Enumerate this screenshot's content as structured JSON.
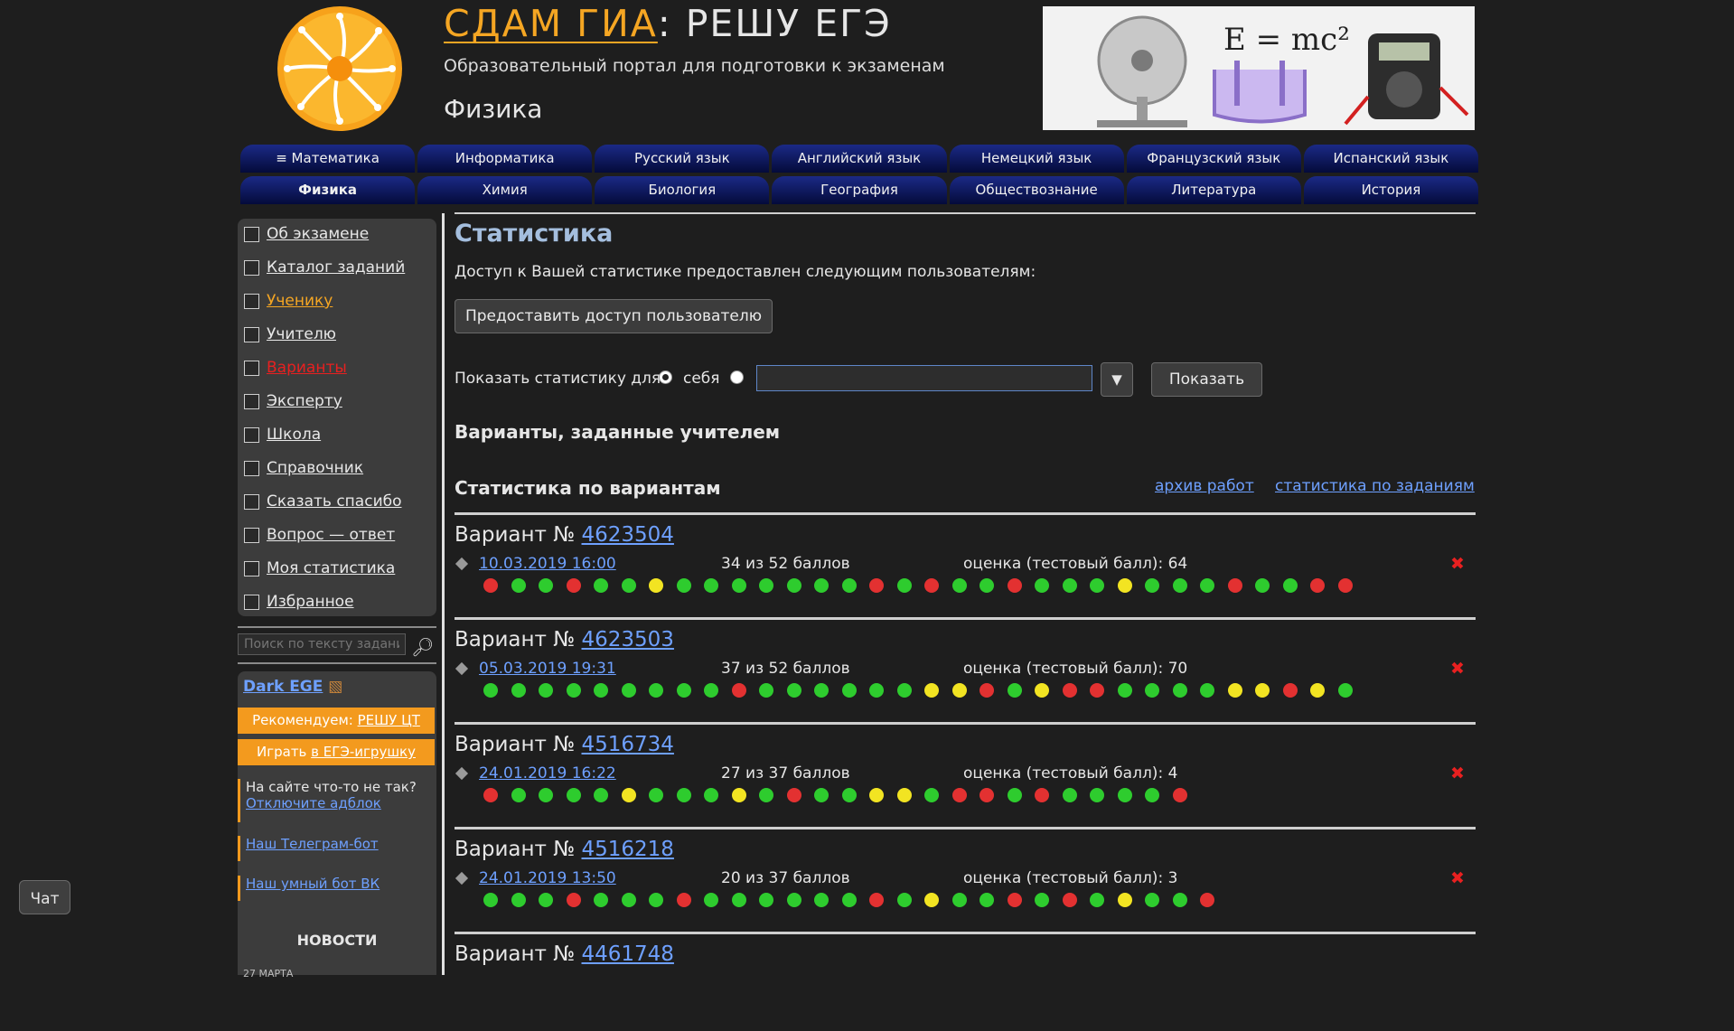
{
  "header": {
    "brand": "СДАМ ГИА",
    "separator": ": ",
    "site": "РЕШУ ЕГЭ",
    "subtitle": "Образовательный портал для подготовки к экзаменам",
    "subject": "Физика",
    "banner_formula": "E = mc²"
  },
  "subject_tabs": {
    "row1": [
      "≡ Математика",
      "Информатика",
      "Русский язык",
      "Английский язык",
      "Немецкий язык",
      "Французский язык",
      "Испанский язык"
    ],
    "row2": [
      "Физика",
      "Химия",
      "Биология",
      "География",
      "Обществознание",
      "Литература",
      "История"
    ],
    "active": "Физика"
  },
  "sidebar": {
    "items": [
      {
        "label": "Об экзамене",
        "style": "normal"
      },
      {
        "label": "Каталог заданий",
        "style": "normal"
      },
      {
        "label": "Ученику",
        "style": "orange"
      },
      {
        "label": "Учителю",
        "style": "normal"
      },
      {
        "label": "Варианты",
        "style": "red"
      },
      {
        "label": "Эксперту",
        "style": "normal"
      },
      {
        "label": "Школа",
        "style": "normal"
      },
      {
        "label": "Справочник",
        "style": "normal"
      },
      {
        "label": "Сказать спасибо",
        "style": "normal"
      },
      {
        "label": "Вопрос — ответ",
        "style": "normal"
      },
      {
        "label": "Моя статистика",
        "style": "normal"
      },
      {
        "label": "Избранное",
        "style": "normal"
      }
    ],
    "search_placeholder": "Поиск по тексту задания",
    "dark_ege": "Dark EGE",
    "promo1_prefix": "Рекомендуем: ",
    "promo1_link": "РЕШУ ЦТ",
    "promo2_prefix": "Играть ",
    "promo2_link": "в ЕГЭ-игрушку",
    "adblock_text": "На сайте что-то не так?",
    "adblock_link": "Отключите адблок",
    "telegram_link": "Наш Телеграм-бот",
    "vk_link": "Наш умный бот ВК",
    "news_title": "НОВОСТИ",
    "news_date": "27 МАРТА"
  },
  "chat_label": "Чат",
  "main": {
    "title": "Статистика",
    "access_text": "Доступ к Вашей статистике предоставлен следующим пользователям:",
    "grant_button": "Предоставить доступ пользователю",
    "show_stats_label": "Показать статистику для",
    "radio_self_label": "себя",
    "show_button": "Показать",
    "teacher_variants_heading": "Варианты, заданные учителем",
    "variant_stats_heading": "Статистика по вариантам",
    "archive_link": "архив работ",
    "task_stats_link": "статистика по заданиям",
    "variant_prefix": "Вариант № "
  },
  "status_colors": {
    "g": "#2ecc2e",
    "r": "#e33131",
    "y": "#f2e422"
  },
  "variants": [
    {
      "number": "4623504",
      "date": "10.03.2019 16:00",
      "score": "34 из 52 баллов",
      "grade": "оценка (тестовый балл): 64",
      "results": [
        "r",
        "g",
        "g",
        "r",
        "g",
        "g",
        "y",
        "g",
        "g",
        "g",
        "g",
        "g",
        "g",
        "g",
        "r",
        "g",
        "r",
        "g",
        "g",
        "r",
        "g",
        "g",
        "g",
        "y",
        "g",
        "g",
        "g",
        "r",
        "g",
        "g",
        "r",
        "r"
      ]
    },
    {
      "number": "4623503",
      "date": "05.03.2019 19:31",
      "score": "37 из 52 баллов",
      "grade": "оценка (тестовый балл): 70",
      "results": [
        "g",
        "g",
        "g",
        "g",
        "g",
        "g",
        "g",
        "g",
        "g",
        "r",
        "g",
        "g",
        "g",
        "g",
        "g",
        "g",
        "y",
        "y",
        "r",
        "g",
        "y",
        "r",
        "r",
        "g",
        "g",
        "g",
        "g",
        "y",
        "y",
        "r",
        "y",
        "g"
      ]
    },
    {
      "number": "4516734",
      "date": "24.01.2019 16:22",
      "score": "27 из 37 баллов",
      "grade": "оценка (тестовый балл): 4",
      "results": [
        "r",
        "g",
        "g",
        "g",
        "g",
        "y",
        "g",
        "g",
        "g",
        "y",
        "g",
        "r",
        "g",
        "g",
        "y",
        "y",
        "g",
        "r",
        "r",
        "g",
        "r",
        "g",
        "g",
        "g",
        "g",
        "r"
      ]
    },
    {
      "number": "4516218",
      "date": "24.01.2019 13:50",
      "score": "20 из 37 баллов",
      "grade": "оценка (тестовый балл): 3",
      "results": [
        "g",
        "g",
        "g",
        "r",
        "g",
        "g",
        "g",
        "r",
        "g",
        "g",
        "g",
        "g",
        "g",
        "g",
        "r",
        "g",
        "y",
        "g",
        "g",
        "r",
        "g",
        "r",
        "g",
        "y",
        "g",
        "g",
        "r"
      ]
    },
    {
      "number": "4461748"
    }
  ]
}
